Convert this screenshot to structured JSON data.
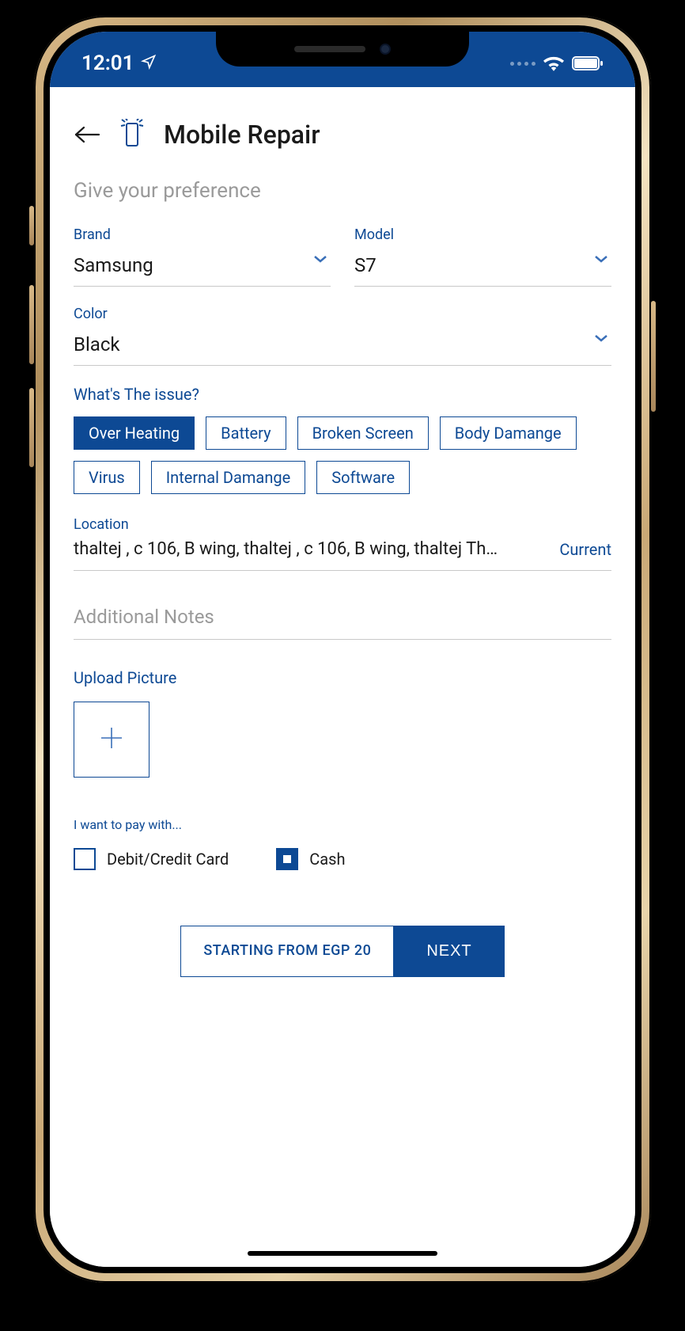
{
  "statusbar": {
    "time": "12:01"
  },
  "header": {
    "title": "Mobile Repair"
  },
  "subtitle": "Give your preference",
  "fields": {
    "brand": {
      "label": "Brand",
      "value": "Samsung"
    },
    "model": {
      "label": "Model",
      "value": "S7"
    },
    "color": {
      "label": "Color",
      "value": "Black"
    }
  },
  "issue": {
    "label": "What's The issue?",
    "options": [
      {
        "label": "Over Heating",
        "selected": true
      },
      {
        "label": "Battery",
        "selected": false
      },
      {
        "label": "Broken Screen",
        "selected": false
      },
      {
        "label": "Body Damange",
        "selected": false
      },
      {
        "label": "Virus",
        "selected": false
      },
      {
        "label": "Internal Damange",
        "selected": false
      },
      {
        "label": "Software",
        "selected": false
      }
    ]
  },
  "location": {
    "label": "Location",
    "value": "thaltej , c 106, B wing, thaltej , c 106, B wing, thaltej  Th…",
    "current_link": "Current"
  },
  "notes": {
    "placeholder": "Additional Notes"
  },
  "upload": {
    "label": "Upload Picture"
  },
  "payment": {
    "title": "I want to pay with...",
    "options": [
      {
        "label": "Debit/Credit Card",
        "checked": false
      },
      {
        "label": "Cash",
        "checked": true
      }
    ]
  },
  "footer": {
    "price_label": "STARTING FROM EGP 20",
    "next_label": "NEXT"
  }
}
